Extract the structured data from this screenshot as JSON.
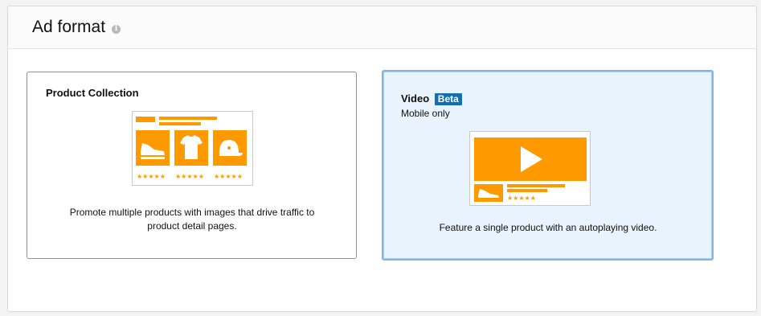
{
  "header": {
    "title": "Ad format",
    "info_icon": "info-icon"
  },
  "cards": [
    {
      "id": "product-collection",
      "title": "Product Collection",
      "description": "Promote multiple products with images that drive traffic to product detail pages.",
      "selected": false
    },
    {
      "id": "video",
      "title": "Video",
      "badge": "Beta",
      "subtitle": "Mobile only",
      "description": "Feature a single product with an autoplaying video.",
      "selected": true
    }
  ],
  "colors": {
    "accent_orange": "#ff9900",
    "beta_blue": "#146eb4",
    "selected_bg": "#e8f3fd",
    "selected_border": "#7fb3ea"
  },
  "icons": [
    "shoe-icon",
    "tshirt-icon",
    "cap-icon",
    "play-icon",
    "star-rating-icon"
  ]
}
